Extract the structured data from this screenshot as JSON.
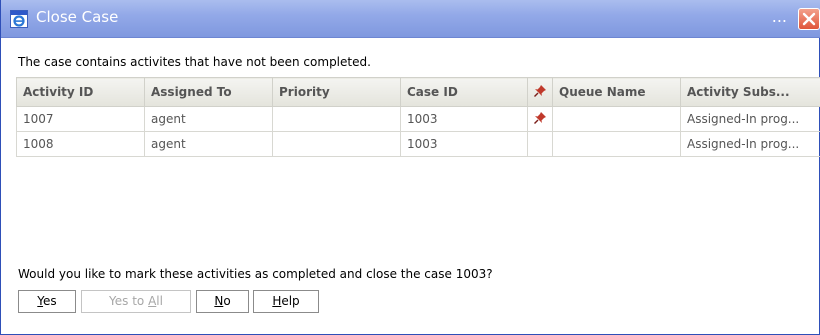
{
  "window": {
    "title": "Close Case",
    "ellipsis": "..."
  },
  "message": "The case contains activites that have not been completed.",
  "table": {
    "columns": [
      "Activity ID",
      "Assigned To",
      "Priority",
      "Case ID",
      "",
      "Queue Name",
      "Activity Subs..."
    ],
    "rows": [
      {
        "activity_id": "1007",
        "assigned_to": "agent",
        "priority": "",
        "case_id": "1003",
        "pinned": true,
        "queue_name": "",
        "activity_status": "Assigned-In prog..."
      },
      {
        "activity_id": "1008",
        "assigned_to": "agent",
        "priority": "",
        "case_id": "1003",
        "pinned": false,
        "queue_name": "",
        "activity_status": "Assigned-In prog..."
      }
    ]
  },
  "prompt": "Would you like to mark these activities as completed and close the case 1003?",
  "buttons": {
    "yes": {
      "pre": "",
      "key": "Y",
      "post": "es"
    },
    "yes_to_all": {
      "pre": "Yes to ",
      "key": "A",
      "post": "ll"
    },
    "no": {
      "pre": "",
      "key": "N",
      "post": "o"
    },
    "help": {
      "pre": "",
      "key": "H",
      "post": "elp"
    }
  },
  "icons": {
    "title": "ie-window-icon",
    "close": "close-x-icon",
    "pin": "pushpin-icon"
  },
  "colors": {
    "titlebar": "#93a9e8",
    "close_button": "#e0553a",
    "pin": "#c0392b"
  }
}
